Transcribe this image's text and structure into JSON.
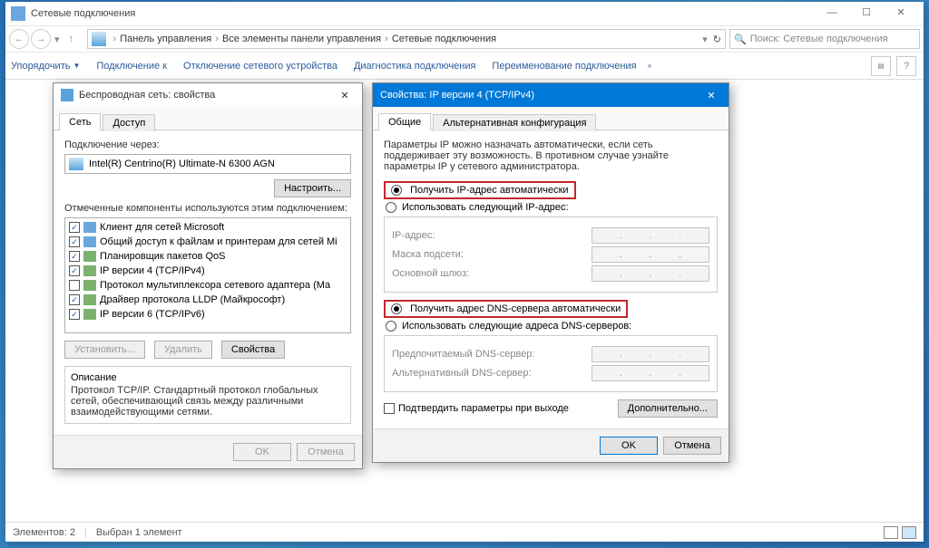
{
  "explorer": {
    "title": "Сетевые подключения",
    "breadcrumbs": [
      "Панель управления",
      "Все элементы панели управления",
      "Сетевые подключения"
    ],
    "search_placeholder": "Поиск: Сетевые подключения",
    "toolbar": {
      "organize": "Упорядочить",
      "connect": "Подключение к",
      "disable": "Отключение сетевого устройства",
      "diagnose": "Диагностика подключения",
      "rename": "Переименование подключения"
    },
    "status_elements": "Элементов: 2",
    "status_selected": "Выбран 1 элемент"
  },
  "props_dialog": {
    "title": "Беспроводная сеть: свойства",
    "tab_net": "Сеть",
    "tab_access": "Доступ",
    "connect_via_label": "Подключение через:",
    "adapter": "Intel(R) Centrino(R) Ultimate-N 6300 AGN",
    "configure_btn": "Настроить...",
    "components_label": "Отмеченные компоненты используются этим подключением:",
    "items": [
      {
        "checked": true,
        "iconClass": "mapicon",
        "label": "Клиент для сетей Microsoft"
      },
      {
        "checked": true,
        "iconClass": "mapicon",
        "label": "Общий доступ к файлам и принтерам для сетей Mi"
      },
      {
        "checked": true,
        "iconClass": "proto-icon",
        "label": "Планировщик пакетов QoS"
      },
      {
        "checked": true,
        "iconClass": "proto-icon",
        "label": "IP версии 4 (TCP/IPv4)"
      },
      {
        "checked": false,
        "iconClass": "proto-icon",
        "label": "Протокол мультиплексора сетевого адаптера (Ма"
      },
      {
        "checked": true,
        "iconClass": "proto-icon",
        "label": "Драйвер протокола LLDP (Майкрософт)"
      },
      {
        "checked": true,
        "iconClass": "proto-icon",
        "label": "IP версии 6 (TCP/IPv6)"
      }
    ],
    "install_btn": "Установить...",
    "remove_btn": "Удалить",
    "props_btn": "Свойства",
    "desc_label": "Описание",
    "desc_text": "Протокол TCP/IP. Стандартный протокол глобальных сетей, обеспечивающий связь между различными взаимодействующими сетями.",
    "ok": "OK",
    "cancel": "Отмена"
  },
  "ip_dialog": {
    "title": "Свойства: IP версии 4 (TCP/IPv4)",
    "tab_general": "Общие",
    "tab_alt": "Альтернативная конфигурация",
    "intro": "Параметры IP можно назначать автоматически, если сеть поддерживает эту возможность. В противном случае узнайте параметры IP у сетевого администратора.",
    "radio_ip_auto": "Получить IP-адрес автоматически",
    "radio_ip_manual": "Использовать следующий IP-адрес:",
    "ip_label": "IP-адрес:",
    "mask_label": "Маска подсети:",
    "gw_label": "Основной шлюз:",
    "radio_dns_auto": "Получить адрес DNS-сервера автоматически",
    "radio_dns_manual": "Использовать следующие адреса DNS-серверов:",
    "dns1_label": "Предпочитаемый DNS-сервер:",
    "dns2_label": "Альтернативный DNS-сервер:",
    "confirm_checkbox": "Подтвердить параметры при выходе",
    "advanced_btn": "Дополнительно...",
    "ok": "OK",
    "cancel": "Отмена"
  }
}
